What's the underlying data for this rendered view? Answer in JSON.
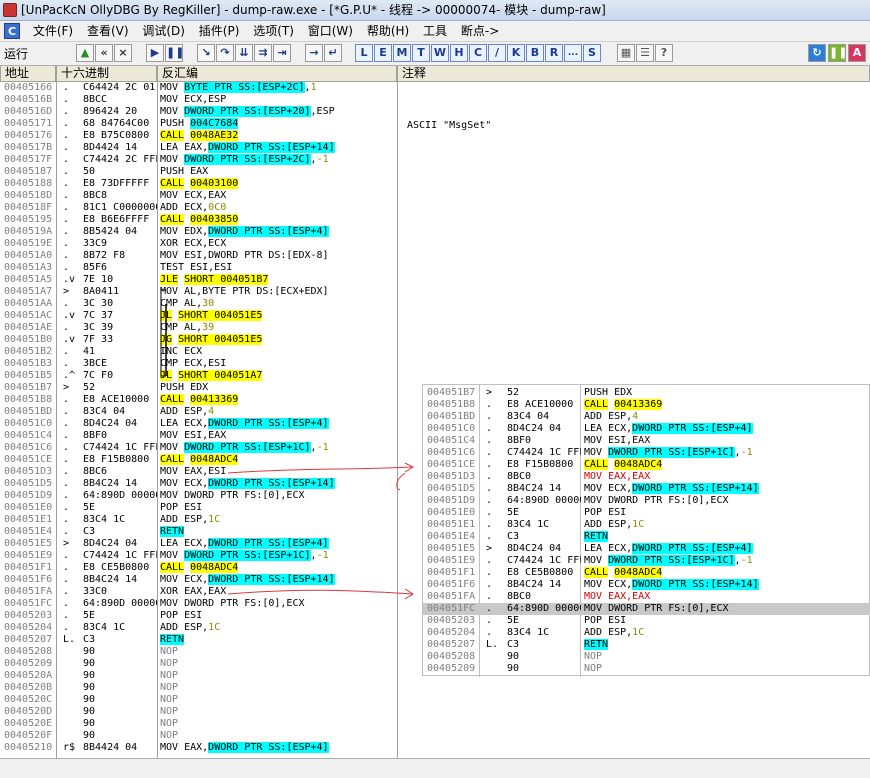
{
  "title": "[UnPacKcN OllyDBG By RegKiller] - dump-raw.exe - [*G.P.U* - 线程 -> 00000074- 模块 - dump-raw]",
  "menu": {
    "c_label": "C",
    "items": [
      "文件(F)",
      "查看(V)",
      "调试(D)",
      "插件(P)",
      "选项(T)",
      "窗口(W)",
      "帮助(H)",
      "工具",
      "断点->"
    ]
  },
  "toolbar": {
    "run_label": "运行",
    "letters": [
      "L",
      "E",
      "M",
      "T",
      "W",
      "H",
      "C",
      "/",
      "K",
      "B",
      "R",
      "...",
      "S"
    ]
  },
  "headers": {
    "addr": "地址",
    "hex": "十六进制",
    "disasm": "反汇编",
    "comment": "注释"
  },
  "comment_text": "ASCII \"MsgSet\"",
  "rows": [
    {
      "addr": "00405166",
      "mark": ".",
      "hex": "C64424 2C 01",
      "dis": [
        [
          "MOV ",
          ""
        ],
        [
          "BYTE PTR SS:[ESP+2C]",
          "b"
        ],
        [
          ",",
          ""
        ],
        [
          "1",
          "n"
        ]
      ]
    },
    {
      "addr": "0040516B",
      "mark": ".",
      "hex": "8BCC",
      "dis": [
        [
          "MOV ECX,ESP",
          ""
        ]
      ]
    },
    {
      "addr": "0040516D",
      "mark": ".",
      "hex": "896424 20",
      "dis": [
        [
          "MOV ",
          ""
        ],
        [
          "DWORD PTR SS:[ESP+20]",
          "b"
        ],
        [
          ",ESP",
          ""
        ]
      ]
    },
    {
      "addr": "00405171",
      "mark": ".",
      "hex": "68 84764C00",
      "dis": [
        [
          "PUSH ",
          ""
        ],
        [
          "004C7684",
          "b"
        ]
      ]
    },
    {
      "addr": "00405176",
      "mark": ".",
      "hex": "E8 B75C0800",
      "dis": [
        [
          "CALL",
          "y"
        ],
        [
          " ",
          ""
        ],
        [
          "0048AE32",
          "y"
        ]
      ]
    },
    {
      "addr": "0040517B",
      "mark": ".",
      "hex": "8D4424 14",
      "dis": [
        [
          "LEA EAX,",
          ""
        ],
        [
          "DWORD PTR SS:[ESP+14]",
          "b"
        ]
      ]
    },
    {
      "addr": "0040517F",
      "mark": ".",
      "hex": "C74424 2C FFFF",
      "dis": [
        [
          "MOV ",
          ""
        ],
        [
          "DWORD PTR SS:[ESP+2C]",
          "b"
        ],
        [
          ",",
          ""
        ],
        [
          "-1",
          "n"
        ]
      ]
    },
    {
      "addr": "00405187",
      "mark": ".",
      "hex": "50",
      "dis": [
        [
          "PUSH EAX",
          ""
        ]
      ]
    },
    {
      "addr": "00405188",
      "mark": ".",
      "hex": "E8 73DFFFFF",
      "dis": [
        [
          "CALL",
          "y"
        ],
        [
          " ",
          ""
        ],
        [
          "00403100",
          "y"
        ]
      ]
    },
    {
      "addr": "0040518D",
      "mark": ".",
      "hex": "8BC8",
      "dis": [
        [
          "MOV ECX,EAX",
          ""
        ]
      ]
    },
    {
      "addr": "0040518F",
      "mark": ".",
      "hex": "81C1 C0000000",
      "dis": [
        [
          "ADD ECX,",
          ""
        ],
        [
          "0C0",
          "n"
        ]
      ]
    },
    {
      "addr": "00405195",
      "mark": ".",
      "hex": "E8 B6E6FFFF",
      "dis": [
        [
          "CALL",
          "y"
        ],
        [
          " ",
          ""
        ],
        [
          "00403850",
          "y"
        ]
      ]
    },
    {
      "addr": "0040519A",
      "mark": ".",
      "hex": "8B5424 04",
      "dis": [
        [
          "MOV EDX,",
          ""
        ],
        [
          "DWORD PTR SS:[ESP+4]",
          "b"
        ]
      ]
    },
    {
      "addr": "0040519E",
      "mark": ".",
      "hex": "33C9",
      "dis": [
        [
          "XOR ECX,ECX",
          ""
        ]
      ]
    },
    {
      "addr": "004051A0",
      "mark": ".",
      "hex": "8B72 F8",
      "dis": [
        [
          "MOV ESI,DWORD PTR DS:[EDX-8]",
          ""
        ]
      ]
    },
    {
      "addr": "004051A3",
      "mark": ".",
      "hex": "85F6",
      "dis": [
        [
          "TEST ESI,ESI",
          ""
        ]
      ]
    },
    {
      "addr": "004051A5",
      "mark": ".v",
      "hex": "7E 10",
      "dis": [
        [
          "JLE",
          "y"
        ],
        [
          " ",
          ""
        ],
        [
          "SHORT 004051B7",
          "y"
        ]
      ]
    },
    {
      "addr": "004051A7",
      "mark": ">",
      "hex": "8A0411",
      "dis": [
        [
          "MOV AL,BYTE PTR DS:[ECX+EDX]",
          ""
        ]
      ]
    },
    {
      "addr": "004051AA",
      "mark": ".",
      "hex": "3C 30",
      "dis": [
        [
          "CMP AL,",
          ""
        ],
        [
          "30",
          "n"
        ]
      ]
    },
    {
      "addr": "004051AC",
      "mark": ".v",
      "hex": "7C 37",
      "dis": [
        [
          "JL",
          "y"
        ],
        [
          " ",
          ""
        ],
        [
          "SHORT 004051E5",
          "y"
        ]
      ]
    },
    {
      "addr": "004051AE",
      "mark": ".",
      "hex": "3C 39",
      "dis": [
        [
          "CMP AL,",
          ""
        ],
        [
          "39",
          "n"
        ]
      ]
    },
    {
      "addr": "004051B0",
      "mark": ".v",
      "hex": "7F 33",
      "dis": [
        [
          "JG",
          "y"
        ],
        [
          " ",
          ""
        ],
        [
          "SHORT 004051E5",
          "y"
        ]
      ]
    },
    {
      "addr": "004051B2",
      "mark": ".",
      "hex": "41",
      "dis": [
        [
          "INC ECX",
          ""
        ]
      ]
    },
    {
      "addr": "004051B3",
      "mark": ".",
      "hex": "3BCE",
      "dis": [
        [
          "CMP ECX,ESI",
          ""
        ]
      ]
    },
    {
      "addr": "004051B5",
      "mark": ".^",
      "hex": "7C F0",
      "dis": [
        [
          "JL",
          "y"
        ],
        [
          " ",
          ""
        ],
        [
          "SHORT 004051A7",
          "y"
        ]
      ]
    },
    {
      "addr": "004051B7",
      "mark": ">",
      "hex": "52",
      "dis": [
        [
          "PUSH EDX",
          ""
        ]
      ]
    },
    {
      "addr": "004051B8",
      "mark": ".",
      "hex": "E8 ACE10000",
      "dis": [
        [
          "CALL",
          "y"
        ],
        [
          " ",
          ""
        ],
        [
          "00413369",
          "y"
        ]
      ]
    },
    {
      "addr": "004051BD",
      "mark": ".",
      "hex": "83C4 04",
      "dis": [
        [
          "ADD ESP,",
          ""
        ],
        [
          "4",
          "n"
        ]
      ]
    },
    {
      "addr": "004051C0",
      "mark": ".",
      "hex": "8D4C24 04",
      "dis": [
        [
          "LEA ECX,",
          ""
        ],
        [
          "DWORD PTR SS:[ESP+4]",
          "b"
        ]
      ]
    },
    {
      "addr": "004051C4",
      "mark": ".",
      "hex": "8BF0",
      "dis": [
        [
          "MOV ESI,EAX",
          ""
        ]
      ]
    },
    {
      "addr": "004051C6",
      "mark": ".",
      "hex": "C74424 1C FFFF",
      "dis": [
        [
          "MOV ",
          ""
        ],
        [
          "DWORD PTR SS:[ESP+1C]",
          "b"
        ],
        [
          ",",
          ""
        ],
        [
          "-1",
          "n"
        ]
      ]
    },
    {
      "addr": "004051CE",
      "mark": ".",
      "hex": "E8 F15B0800",
      "dis": [
        [
          "CALL",
          "y"
        ],
        [
          " ",
          ""
        ],
        [
          "0048ADC4",
          "y"
        ]
      ]
    },
    {
      "addr": "004051D3",
      "mark": ".",
      "hex": "8BC6",
      "dis": [
        [
          "MOV EAX,ESI",
          ""
        ]
      ]
    },
    {
      "addr": "004051D5",
      "mark": ".",
      "hex": "8B4C24 14",
      "dis": [
        [
          "MOV ECX,",
          ""
        ],
        [
          "DWORD PTR SS:[ESP+14]",
          "b"
        ]
      ]
    },
    {
      "addr": "004051D9",
      "mark": ".",
      "hex": "64:890D 000000",
      "dis": [
        [
          "MOV DWORD PTR FS:[0],ECX",
          ""
        ]
      ]
    },
    {
      "addr": "004051E0",
      "mark": ".",
      "hex": "5E",
      "dis": [
        [
          "POP ESI",
          ""
        ]
      ]
    },
    {
      "addr": "004051E1",
      "mark": ".",
      "hex": "83C4 1C",
      "dis": [
        [
          "ADD ESP,",
          ""
        ],
        [
          "1C",
          "n"
        ]
      ]
    },
    {
      "addr": "004051E4",
      "mark": ".",
      "hex": "C3",
      "dis": [
        [
          "RETN",
          "b"
        ]
      ]
    },
    {
      "addr": "004051E5",
      "mark": ">",
      "hex": "8D4C24 04",
      "dis": [
        [
          "LEA ECX,",
          ""
        ],
        [
          "DWORD PTR SS:[ESP+4]",
          "b"
        ]
      ]
    },
    {
      "addr": "004051E9",
      "mark": ".",
      "hex": "C74424 1C FFFF",
      "dis": [
        [
          "MOV ",
          ""
        ],
        [
          "DWORD PTR SS:[ESP+1C]",
          "b"
        ],
        [
          ",",
          ""
        ],
        [
          "-1",
          "n"
        ]
      ]
    },
    {
      "addr": "004051F1",
      "mark": ".",
      "hex": "E8 CE5B0800",
      "dis": [
        [
          "CALL",
          "y"
        ],
        [
          " ",
          ""
        ],
        [
          "0048ADC4",
          "y"
        ]
      ]
    },
    {
      "addr": "004051F6",
      "mark": ".",
      "hex": "8B4C24 14",
      "dis": [
        [
          "MOV ECX,",
          ""
        ],
        [
          "DWORD PTR SS:[ESP+14]",
          "b"
        ]
      ]
    },
    {
      "addr": "004051FA",
      "mark": ".",
      "hex": "33C0",
      "dis": [
        [
          "XOR EAX,EAX",
          ""
        ]
      ]
    },
    {
      "addr": "004051FC",
      "mark": ".",
      "hex": "64:890D 000000",
      "dis": [
        [
          "MOV DWORD PTR FS:[0],ECX",
          ""
        ]
      ]
    },
    {
      "addr": "00405203",
      "mark": ".",
      "hex": "5E",
      "dis": [
        [
          "POP ESI",
          ""
        ]
      ]
    },
    {
      "addr": "00405204",
      "mark": ".",
      "hex": "83C4 1C",
      "dis": [
        [
          "ADD ESP,",
          ""
        ],
        [
          "1C",
          "n"
        ]
      ]
    },
    {
      "addr": "00405207",
      "mark": "L.",
      "hex": "C3",
      "dis": [
        [
          "RETN",
          "b"
        ]
      ]
    },
    {
      "addr": "00405208",
      "mark": "",
      "hex": "90",
      "dis": [
        [
          "NOP",
          "g"
        ]
      ]
    },
    {
      "addr": "00405209",
      "mark": "",
      "hex": "90",
      "dis": [
        [
          "NOP",
          "g"
        ]
      ]
    },
    {
      "addr": "0040520A",
      "mark": "",
      "hex": "90",
      "dis": [
        [
          "NOP",
          "g"
        ]
      ]
    },
    {
      "addr": "0040520B",
      "mark": "",
      "hex": "90",
      "dis": [
        [
          "NOP",
          "g"
        ]
      ]
    },
    {
      "addr": "0040520C",
      "mark": "",
      "hex": "90",
      "dis": [
        [
          "NOP",
          "g"
        ]
      ]
    },
    {
      "addr": "0040520D",
      "mark": "",
      "hex": "90",
      "dis": [
        [
          "NOP",
          "g"
        ]
      ]
    },
    {
      "addr": "0040520E",
      "mark": "",
      "hex": "90",
      "dis": [
        [
          "NOP",
          "g"
        ]
      ]
    },
    {
      "addr": "0040520F",
      "mark": "",
      "hex": "90",
      "dis": [
        [
          "NOP",
          "g"
        ]
      ]
    },
    {
      "addr": "00405210",
      "mark": "r$",
      "hex": "8B4424 04",
      "dis": [
        [
          "MOV EAX,",
          ""
        ],
        [
          "DWORD PTR SS:[ESP+4]",
          "b"
        ]
      ]
    }
  ],
  "popup_rows": [
    {
      "addr": "004051B7",
      "mark": ">",
      "hex": "52",
      "dis": [
        [
          "PUSH EDX",
          ""
        ]
      ]
    },
    {
      "addr": "004051B8",
      "mark": ".",
      "hex": "E8 ACE10000",
      "dis": [
        [
          "CALL",
          "y"
        ],
        [
          " ",
          ""
        ],
        [
          "00413369",
          "y"
        ]
      ]
    },
    {
      "addr": "004051BD",
      "mark": ".",
      "hex": "83C4 04",
      "dis": [
        [
          "ADD ESP,",
          ""
        ],
        [
          "4",
          "n"
        ]
      ]
    },
    {
      "addr": "004051C0",
      "mark": ".",
      "hex": "8D4C24 04",
      "dis": [
        [
          "LEA ECX,",
          ""
        ],
        [
          "DWORD PTR SS:[ESP+4]",
          "b"
        ]
      ]
    },
    {
      "addr": "004051C4",
      "mark": ".",
      "hex": "8BF0",
      "dis": [
        [
          "MOV ESI,EAX",
          ""
        ]
      ]
    },
    {
      "addr": "004051C6",
      "mark": ".",
      "hex": "C74424 1C FFFF",
      "dis": [
        [
          "MOV ",
          ""
        ],
        [
          "DWORD PTR SS:[ESP+1C]",
          "b"
        ],
        [
          ",",
          ""
        ],
        [
          "-1",
          "n"
        ]
      ]
    },
    {
      "addr": "004051CE",
      "mark": ".",
      "hex": "E8 F15B0800",
      "dis": [
        [
          "CALL",
          "y"
        ],
        [
          " ",
          ""
        ],
        [
          "0048ADC4",
          "y"
        ]
      ]
    },
    {
      "addr": "004051D3",
      "mark": ".",
      "hex": "8BC0",
      "dis": [
        [
          "MOV EAX,EAX",
          "r"
        ]
      ]
    },
    {
      "addr": "004051D5",
      "mark": ".",
      "hex": "8B4C24 14",
      "dis": [
        [
          "MOV ECX,",
          ""
        ],
        [
          "DWORD PTR SS:[ESP+14]",
          "b"
        ]
      ]
    },
    {
      "addr": "004051D9",
      "mark": ".",
      "hex": "64:890D 000000",
      "dis": [
        [
          "MOV DWORD PTR FS:[0],ECX",
          ""
        ]
      ]
    },
    {
      "addr": "004051E0",
      "mark": ".",
      "hex": "5E",
      "dis": [
        [
          "POP ESI",
          ""
        ]
      ]
    },
    {
      "addr": "004051E1",
      "mark": ".",
      "hex": "83C4 1C",
      "dis": [
        [
          "ADD ESP,",
          ""
        ],
        [
          "1C",
          "n"
        ]
      ]
    },
    {
      "addr": "004051E4",
      "mark": ".",
      "hex": "C3",
      "dis": [
        [
          "RETN",
          "b"
        ]
      ]
    },
    {
      "addr": "004051E5",
      "mark": ">",
      "hex": "8D4C24 04",
      "dis": [
        [
          "LEA ECX,",
          ""
        ],
        [
          "DWORD PTR SS:[ESP+4]",
          "b"
        ]
      ]
    },
    {
      "addr": "004051E9",
      "mark": ".",
      "hex": "C74424 1C FFFF",
      "dis": [
        [
          "MOV ",
          ""
        ],
        [
          "DWORD PTR SS:[ESP+1C]",
          "b"
        ],
        [
          ",",
          ""
        ],
        [
          "-1",
          "n"
        ]
      ]
    },
    {
      "addr": "004051F1",
      "mark": ".",
      "hex": "E8 CE5B0800",
      "dis": [
        [
          "CALL",
          "y"
        ],
        [
          " ",
          ""
        ],
        [
          "0048ADC4",
          "y"
        ]
      ]
    },
    {
      "addr": "004051F6",
      "mark": ".",
      "hex": "8B4C24 14",
      "dis": [
        [
          "MOV ECX,",
          ""
        ],
        [
          "DWORD PTR SS:[ESP+14]",
          "b"
        ]
      ]
    },
    {
      "addr": "004051FA",
      "mark": ".",
      "hex": "8BC0",
      "dis": [
        [
          "MOV EAX,EAX",
          "r"
        ]
      ]
    },
    {
      "addr": "004051FC",
      "mark": ".",
      "hex": "64:890D 000000",
      "dis": [
        [
          "MOV DWORD PTR FS:[0],ECX",
          ""
        ]
      ],
      "selected": true
    },
    {
      "addr": "00405203",
      "mark": ".",
      "hex": "5E",
      "dis": [
        [
          "POP ESI",
          ""
        ]
      ]
    },
    {
      "addr": "00405204",
      "mark": ".",
      "hex": "83C4 1C",
      "dis": [
        [
          "ADD ESP,",
          ""
        ],
        [
          "1C",
          "n"
        ]
      ]
    },
    {
      "addr": "00405207",
      "mark": "L.",
      "hex": "C3",
      "dis": [
        [
          "RETN",
          "b"
        ]
      ]
    },
    {
      "addr": "00405208",
      "mark": "",
      "hex": "90",
      "dis": [
        [
          "NOP",
          "g"
        ]
      ]
    },
    {
      "addr": "00405209",
      "mark": "",
      "hex": "90",
      "dis": [
        [
          "NOP",
          "g"
        ]
      ]
    }
  ],
  "colors": {
    "highlight_blue": "#00ffff",
    "highlight_yellow": "#ffff00",
    "changed_red": "#d00000",
    "address_gray": "#808080",
    "arrow_red": "#d83a3a"
  }
}
